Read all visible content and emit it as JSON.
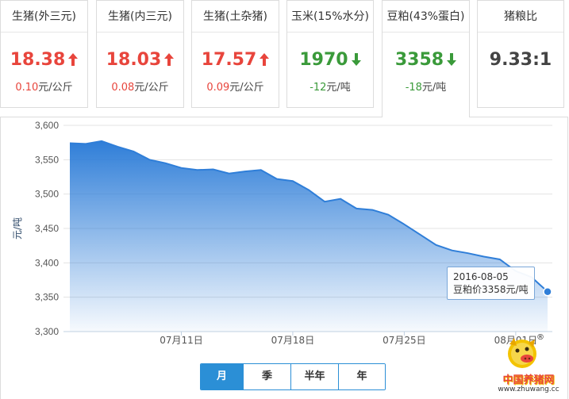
{
  "cards": [
    {
      "title": "生猪(外三元)",
      "price": "18.38",
      "trend": "up",
      "change": "0.10",
      "unit": "元/公斤"
    },
    {
      "title": "生猪(内三元)",
      "price": "18.03",
      "trend": "up",
      "change": "0.08",
      "unit": "元/公斤"
    },
    {
      "title": "生猪(土杂猪)",
      "price": "17.57",
      "trend": "up",
      "change": "0.09",
      "unit": "元/公斤"
    },
    {
      "title": "玉米(15%水分)",
      "price": "1970",
      "trend": "down",
      "change": "-12",
      "unit": "元/吨"
    },
    {
      "title": "豆粕(43%蛋白)",
      "price": "3358",
      "trend": "down",
      "change": "-18",
      "unit": "元/吨"
    },
    {
      "title": "猪粮比",
      "price": "9.33:1",
      "trend": "neutral",
      "change": "",
      "unit": ""
    }
  ],
  "active_card": 4,
  "colors": {
    "up": "#e8453c",
    "down": "#3a9a3a",
    "accent": "#2b8fd6",
    "line": "#2f7ed8"
  },
  "chart_data": {
    "type": "area",
    "ylabel": "元/吨",
    "ylim": [
      3300,
      3600
    ],
    "y_ticks": [
      "3,300",
      "3,350",
      "3,400",
      "3,450",
      "3,500",
      "3,550",
      "3,600"
    ],
    "y_tick_values": [
      3300,
      3350,
      3400,
      3450,
      3500,
      3550,
      3600
    ],
    "x_ticks": [
      "07月11日",
      "07月18日",
      "07月25日",
      "08月01日"
    ],
    "x_tick_index": [
      7,
      14,
      21,
      28
    ],
    "values": [
      3574,
      3573,
      3577,
      3569,
      3562,
      3550,
      3545,
      3538,
      3535,
      3536,
      3530,
      3533,
      3535,
      3522,
      3519,
      3506,
      3489,
      3493,
      3479,
      3477,
      3470,
      3456,
      3441,
      3426,
      3418,
      3414,
      3409,
      3405,
      3388,
      3379,
      3358
    ],
    "grid": true,
    "tooltip": {
      "date": "2016-08-05",
      "label": "豆粕价3358元/吨"
    }
  },
  "range_buttons": [
    "月",
    "季",
    "半年",
    "年"
  ],
  "active_range": 0,
  "logo": {
    "name": "中国养猪网",
    "url": "www.zhuwang.cc",
    "reg": "®"
  }
}
